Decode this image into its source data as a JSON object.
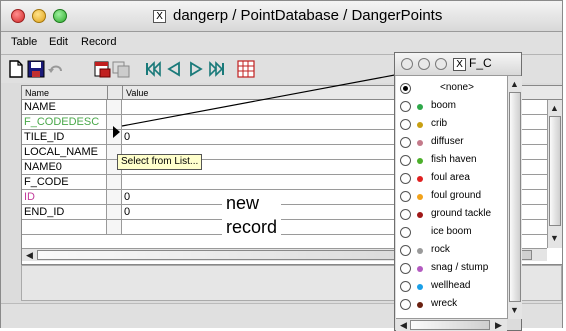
{
  "window": {
    "title": "dangerp / PointDatabase / DangerPoints",
    "x_icon": "X"
  },
  "menubar": {
    "items": [
      {
        "label": "Table"
      },
      {
        "label": "Edit"
      },
      {
        "label": "Record"
      }
    ]
  },
  "toolbar": {
    "icons": [
      "new-record-icon",
      "save-icon",
      "undo-icon",
      "delete-record-icon",
      "copy-record-icon",
      "first-record-icon",
      "previous-record-icon",
      "next-record-icon",
      "last-record-icon",
      "table-view-icon"
    ]
  },
  "grid": {
    "headers": {
      "name": "Name",
      "value": "Value"
    },
    "rows": [
      {
        "name": "NAME",
        "value": "",
        "color": "#000000"
      },
      {
        "name": "F_CODEDESC",
        "value": "",
        "color": "#4aa84a"
      },
      {
        "name": "TILE_ID",
        "value": "0",
        "color": "#000000"
      },
      {
        "name": "LOCAL_NAME",
        "value": "",
        "color": "#000000"
      },
      {
        "name": "NAME0",
        "value": "",
        "color": "#000000"
      },
      {
        "name": "F_CODE",
        "value": "",
        "color": "#000000"
      },
      {
        "name": "ID",
        "value": "0",
        "color": "#c23a9a"
      },
      {
        "name": "END_ID",
        "value": "0",
        "color": "#000000"
      }
    ]
  },
  "tooltip": "Select from List...",
  "annotation": {
    "line1": "new",
    "line2": "record"
  },
  "popup": {
    "title": "F_C",
    "options": [
      {
        "label": "<none>",
        "color": "",
        "selected": true
      },
      {
        "label": "boom",
        "color": "#2ea84a",
        "selected": false
      },
      {
        "label": "crib",
        "color": "#c8a012",
        "selected": false
      },
      {
        "label": "diffuser",
        "color": "#c47a8a",
        "selected": false
      },
      {
        "label": "fish haven",
        "color": "#4caf2a",
        "selected": false
      },
      {
        "label": "foul area",
        "color": "#e02020",
        "selected": false
      },
      {
        "label": "foul ground",
        "color": "#f2a21a",
        "selected": false
      },
      {
        "label": "ground tackle",
        "color": "#a01818",
        "selected": false
      },
      {
        "label": "ice boom",
        "color": "",
        "selected": false
      },
      {
        "label": "rock",
        "color": "#9a9a9a",
        "selected": false
      },
      {
        "label": "snag / stump",
        "color": "#b35ac0",
        "selected": false
      },
      {
        "label": "wellhead",
        "color": "#1aa0e8",
        "selected": false
      },
      {
        "label": "wreck",
        "color": "#6a2010",
        "selected": false
      }
    ]
  },
  "colors": {
    "accent_annotation_line": "#000000"
  }
}
